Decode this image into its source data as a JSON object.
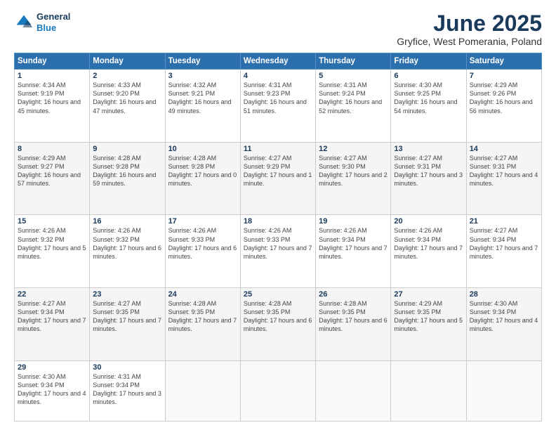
{
  "logo": {
    "line1": "General",
    "line2": "Blue"
  },
  "title": "June 2025",
  "subtitle": "Gryfice, West Pomerania, Poland",
  "header_days": [
    "Sunday",
    "Monday",
    "Tuesday",
    "Wednesday",
    "Thursday",
    "Friday",
    "Saturday"
  ],
  "weeks": [
    [
      {
        "num": "1",
        "rise": "4:34 AM",
        "set": "9:19 PM",
        "daylight": "16 hours and 45 minutes."
      },
      {
        "num": "2",
        "rise": "4:33 AM",
        "set": "9:20 PM",
        "daylight": "16 hours and 47 minutes."
      },
      {
        "num": "3",
        "rise": "4:32 AM",
        "set": "9:21 PM",
        "daylight": "16 hours and 49 minutes."
      },
      {
        "num": "4",
        "rise": "4:31 AM",
        "set": "9:23 PM",
        "daylight": "16 hours and 51 minutes."
      },
      {
        "num": "5",
        "rise": "4:31 AM",
        "set": "9:24 PM",
        "daylight": "16 hours and 52 minutes."
      },
      {
        "num": "6",
        "rise": "4:30 AM",
        "set": "9:25 PM",
        "daylight": "16 hours and 54 minutes."
      },
      {
        "num": "7",
        "rise": "4:29 AM",
        "set": "9:26 PM",
        "daylight": "16 hours and 56 minutes."
      }
    ],
    [
      {
        "num": "8",
        "rise": "4:29 AM",
        "set": "9:27 PM",
        "daylight": "16 hours and 57 minutes."
      },
      {
        "num": "9",
        "rise": "4:28 AM",
        "set": "9:28 PM",
        "daylight": "16 hours and 59 minutes."
      },
      {
        "num": "10",
        "rise": "4:28 AM",
        "set": "9:28 PM",
        "daylight": "17 hours and 0 minutes."
      },
      {
        "num": "11",
        "rise": "4:27 AM",
        "set": "9:29 PM",
        "daylight": "17 hours and 1 minute."
      },
      {
        "num": "12",
        "rise": "4:27 AM",
        "set": "9:30 PM",
        "daylight": "17 hours and 2 minutes."
      },
      {
        "num": "13",
        "rise": "4:27 AM",
        "set": "9:31 PM",
        "daylight": "17 hours and 3 minutes."
      },
      {
        "num": "14",
        "rise": "4:27 AM",
        "set": "9:31 PM",
        "daylight": "17 hours and 4 minutes."
      }
    ],
    [
      {
        "num": "15",
        "rise": "4:26 AM",
        "set": "9:32 PM",
        "daylight": "17 hours and 5 minutes."
      },
      {
        "num": "16",
        "rise": "4:26 AM",
        "set": "9:32 PM",
        "daylight": "17 hours and 6 minutes."
      },
      {
        "num": "17",
        "rise": "4:26 AM",
        "set": "9:33 PM",
        "daylight": "17 hours and 6 minutes."
      },
      {
        "num": "18",
        "rise": "4:26 AM",
        "set": "9:33 PM",
        "daylight": "17 hours and 7 minutes."
      },
      {
        "num": "19",
        "rise": "4:26 AM",
        "set": "9:34 PM",
        "daylight": "17 hours and 7 minutes."
      },
      {
        "num": "20",
        "rise": "4:26 AM",
        "set": "9:34 PM",
        "daylight": "17 hours and 7 minutes."
      },
      {
        "num": "21",
        "rise": "4:27 AM",
        "set": "9:34 PM",
        "daylight": "17 hours and 7 minutes."
      }
    ],
    [
      {
        "num": "22",
        "rise": "4:27 AM",
        "set": "9:34 PM",
        "daylight": "17 hours and 7 minutes."
      },
      {
        "num": "23",
        "rise": "4:27 AM",
        "set": "9:35 PM",
        "daylight": "17 hours and 7 minutes."
      },
      {
        "num": "24",
        "rise": "4:28 AM",
        "set": "9:35 PM",
        "daylight": "17 hours and 7 minutes."
      },
      {
        "num": "25",
        "rise": "4:28 AM",
        "set": "9:35 PM",
        "daylight": "17 hours and 6 minutes."
      },
      {
        "num": "26",
        "rise": "4:28 AM",
        "set": "9:35 PM",
        "daylight": "17 hours and 6 minutes."
      },
      {
        "num": "27",
        "rise": "4:29 AM",
        "set": "9:35 PM",
        "daylight": "17 hours and 5 minutes."
      },
      {
        "num": "28",
        "rise": "4:30 AM",
        "set": "9:34 PM",
        "daylight": "17 hours and 4 minutes."
      }
    ],
    [
      {
        "num": "29",
        "rise": "4:30 AM",
        "set": "9:34 PM",
        "daylight": "17 hours and 4 minutes."
      },
      {
        "num": "30",
        "rise": "4:31 AM",
        "set": "9:34 PM",
        "daylight": "17 hours and 3 minutes."
      },
      null,
      null,
      null,
      null,
      null
    ]
  ]
}
